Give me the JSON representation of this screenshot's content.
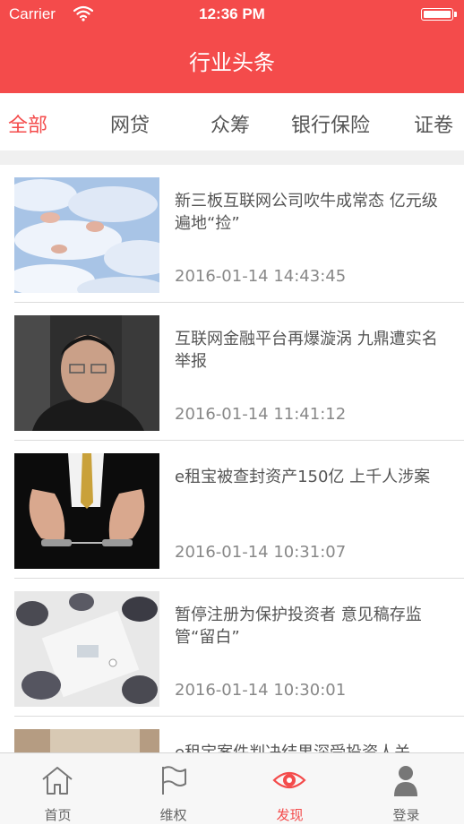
{
  "status_bar": {
    "carrier": "Carrier",
    "time": "12:36 PM"
  },
  "nav": {
    "title": "行业头条"
  },
  "tabs": [
    {
      "label": "全部",
      "active": true
    },
    {
      "label": "网贷",
      "active": false
    },
    {
      "label": "众筹",
      "active": false
    },
    {
      "label": "银行保险",
      "active": false
    },
    {
      "label": "证卷",
      "active": false
    }
  ],
  "articles": [
    {
      "title": "新三板互联网公司吹牛成常态 亿元级遍地“捡”",
      "date": "2016-01-14 14:43:45",
      "image": "flying-pigs-image"
    },
    {
      "title": "互联网金融平台再爆漩涡 九鼎遭实名举报",
      "date": "2016-01-14 11:41:12",
      "image": "man-with-glasses-portrait"
    },
    {
      "title": "e租宝被查封资产150亿 上千人涉案",
      "date": "2016-01-14 10:31:07",
      "image": "handcuffed-hands-image"
    },
    {
      "title": "暂停注册为保护投资者 意见稿存监管“留白”",
      "date": "2016-01-14 10:30:01",
      "image": "business-meeting-image"
    },
    {
      "title": "e租宝案件判决结果深受投资人关",
      "date": "",
      "image": "partial-thumbnail"
    }
  ],
  "tabbar": [
    {
      "label": "首页",
      "icon": "home-icon",
      "active": false
    },
    {
      "label": "维权",
      "icon": "flag-icon",
      "active": false
    },
    {
      "label": "发现",
      "icon": "eye-icon",
      "active": true
    },
    {
      "label": "登录",
      "icon": "user-icon",
      "active": false
    }
  ],
  "colors": {
    "accent": "#f44b4b",
    "text": "#555555",
    "muted": "#888888",
    "tabbar_bg": "#f7f7f7"
  }
}
